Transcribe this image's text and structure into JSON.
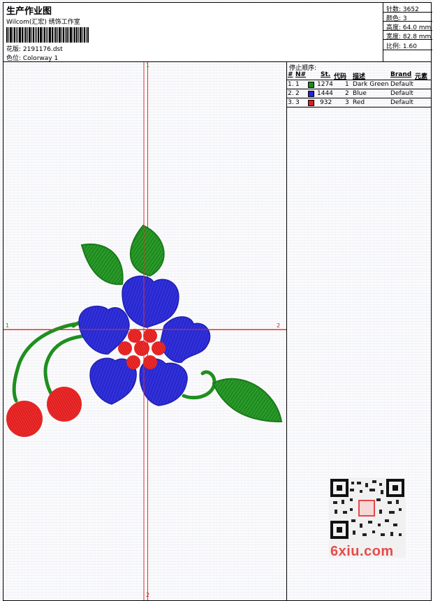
{
  "header": {
    "title": "生产作业图",
    "subtitle": "Wilcom(汇宏) 绣饰工作室",
    "file": "花版: 2191176.dst",
    "color": "色位: Colorway 1"
  },
  "stats": [
    {
      "label": "针数: 3652"
    },
    {
      "label": "颜色: 3"
    },
    {
      "label": "高度: 64.0 mm"
    },
    {
      "label": "宽度: 82.8 mm"
    },
    {
      "label": "比例: 1.60"
    }
  ],
  "stop_sequence": {
    "title": "停止顺序:",
    "headers": [
      "#",
      "N#",
      "St.",
      "代码",
      "描述",
      "Brand",
      "元素"
    ],
    "rows": [
      {
        "num": "1.",
        "n": "1",
        "st": "1274",
        "code": "1",
        "desc": "Dark Green",
        "brand": "Default",
        "color": "#1a8a1a"
      },
      {
        "num": "2.",
        "n": "2",
        "st": "1444",
        "code": "2",
        "desc": "Blue",
        "brand": "Default",
        "color": "#2424d8"
      },
      {
        "num": "3.",
        "n": "3",
        "st": "932",
        "code": "3",
        "desc": "Red",
        "brand": "Default",
        "color": "#e01c1c"
      }
    ]
  },
  "axes": {
    "top": "1",
    "left": "1",
    "right": "2",
    "bottom": "2"
  },
  "watermark": "6xiu.com",
  "colors": {
    "green": "#1f8f1f",
    "blue": "#2a2ad6",
    "red": "#e11d1d",
    "axis": "#e23030"
  }
}
